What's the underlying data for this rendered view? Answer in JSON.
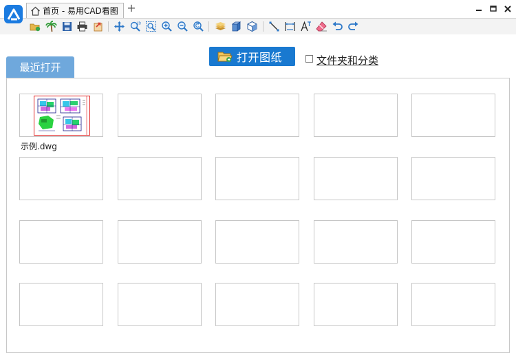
{
  "titlebar": {
    "tab_title": "首页 - 易用CAD看图",
    "new_tab_symbol": "+"
  },
  "colors": {
    "accent": "#1979d0",
    "recent_tab": "#6fa8dc",
    "preview_border": "#e02020"
  },
  "toolbar": {
    "icons": [
      "open-folder-icon",
      "palm-tree-icon",
      "save-icon",
      "print-icon",
      "export-icon",
      "pan-icon",
      "zoom-window-icon",
      "zoom-extents-icon",
      "zoom-in-icon",
      "zoom-out-icon",
      "zoom-previous-icon",
      "layer-icon",
      "3d-box-icon",
      "3d-view-icon",
      "line-measure-icon",
      "dimension-icon",
      "text-icon",
      "eraser-icon",
      "undo-icon",
      "redo-icon"
    ]
  },
  "main": {
    "open_button_label": "打开图纸",
    "folder_checkbox_label": "文件夹和分类",
    "folder_checkbox_checked": false,
    "recent_tab_label": "最近打开",
    "recent_files": [
      {
        "name": "示例.dwg"
      }
    ]
  }
}
